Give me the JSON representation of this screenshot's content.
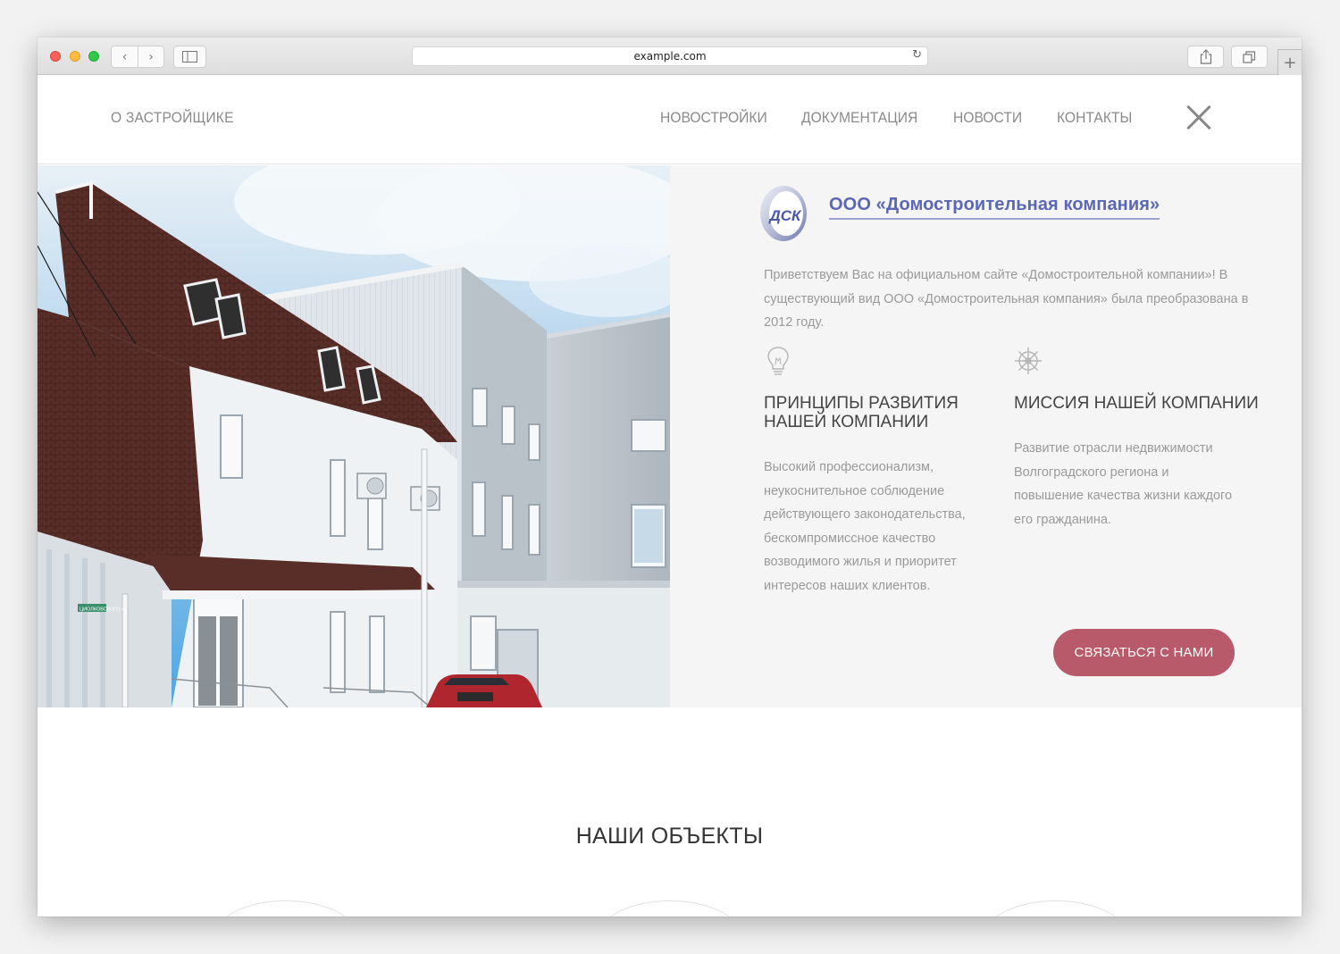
{
  "browser": {
    "url": "example.com",
    "back_icon": "‹",
    "forward_icon": "›",
    "reload_icon": "↻",
    "new_tab_label": "+"
  },
  "header": {
    "brand_link": "О ЗАСТРОЙЩИКЕ",
    "nav": [
      "НОВОСТРОЙКИ",
      "ДОКУМЕНТАЦИЯ",
      "НОВОСТИ",
      "КОНТАКТЫ"
    ],
    "close_icon": "close-icon"
  },
  "hero": {
    "logo_text": "ДСК",
    "company_name": "ООО «Домостроительная компания»",
    "intro": "Приветствуем Вас на официальном сайте «Домостроительной компании»! В существующий вид ООО «Домостроительная компания» была преобразована в 2012 году.",
    "features": [
      {
        "icon": "lightbulb-icon",
        "title": "ПРИНЦИПЫ РАЗВИТИЯ НАШЕЙ КОМПАНИИ",
        "text": "Высокий профессионализм, неукоснительное соблюдение действующего законодательства, бескомпромиссное качество возводимого жилья и приоритет интересов наших клиентов."
      },
      {
        "icon": "ship-wheel-icon",
        "title": "МИССИЯ НАШЕЙ КОМПАНИИ",
        "text": "Развитие отрасли недвижимости Волгоградского региона и повышение качества жизни каждого его гражданина."
      }
    ],
    "cta_label": "СВЯЗАТЬСЯ С НАМИ",
    "street_sign": "ЦИОЛКОВСКОГО 41"
  },
  "objects": {
    "title": "НАШИ ОБЪЕКТЫ"
  },
  "colors": {
    "accent": "#b85a6a",
    "brand_blue": "#5b67b4",
    "sky": "#5aaee8",
    "roof": "#5a2e28"
  }
}
